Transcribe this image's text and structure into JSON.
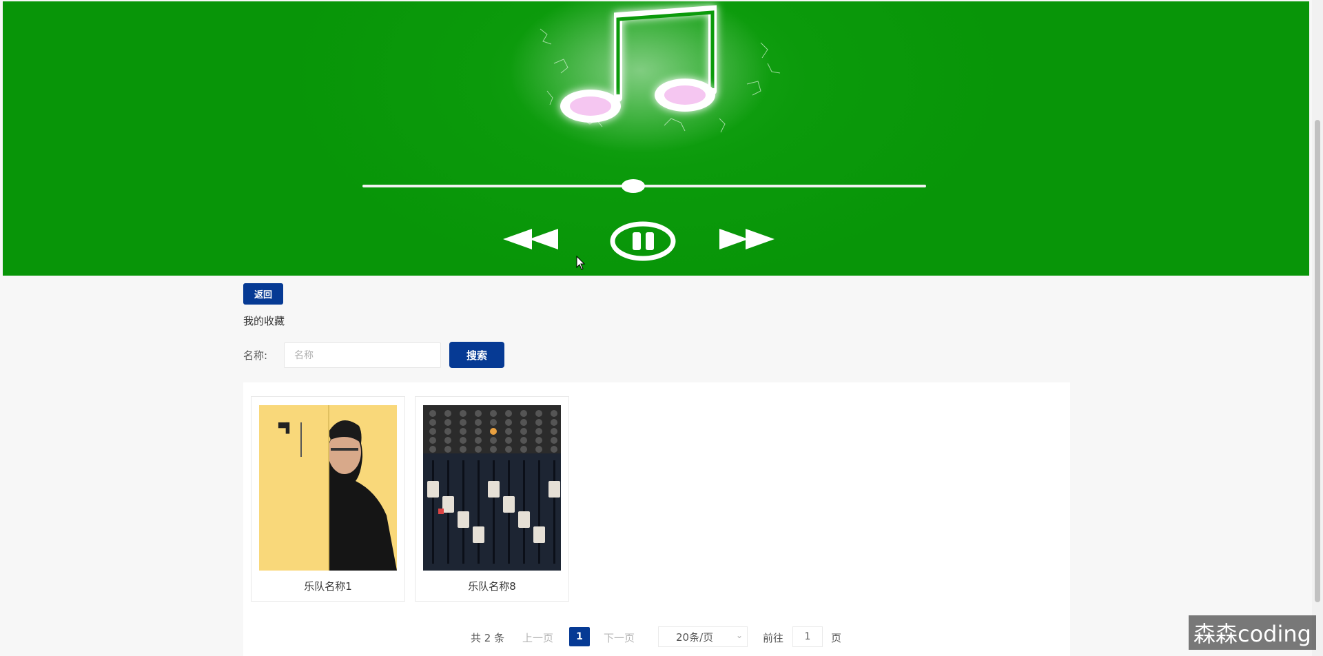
{
  "player": {
    "progress": 0.48,
    "controls": {
      "rewind_icon": "rewind-icon",
      "pause_icon": "pause-icon",
      "forward_icon": "fast-forward-icon"
    },
    "colors": {
      "background": "#089508",
      "accent": "#ffffff",
      "note_glow": "#f7c8f4"
    }
  },
  "toolbar": {
    "back_label": "返回"
  },
  "section": {
    "title": "我的收藏"
  },
  "search": {
    "label": "名称:",
    "placeholder": "名称",
    "value": "",
    "button_label": "搜索"
  },
  "favorites": [
    {
      "name": "乐队名称1",
      "cover": "portrait-album-cover"
    },
    {
      "name": "乐队名称8",
      "cover": "mixing-console-cover"
    }
  ],
  "pagination": {
    "total_text": "共 2 条",
    "prev_label": "上一页",
    "current_page": "1",
    "next_label": "下一页",
    "page_size": "20条/页",
    "goto_label": "前往",
    "goto_value": "1",
    "page_suffix": "页"
  },
  "watermark": {
    "text": "森森coding"
  },
  "theme": {
    "primary": "#063a94"
  }
}
